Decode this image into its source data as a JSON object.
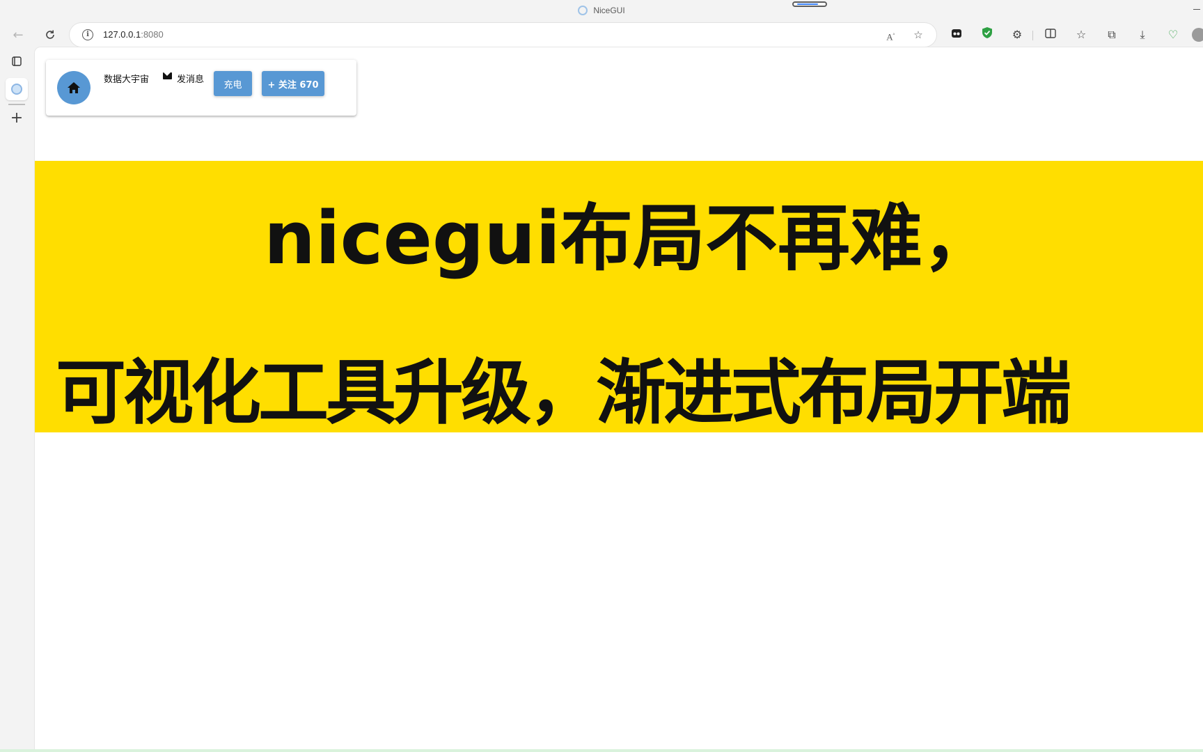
{
  "window": {
    "title": "NiceGUI"
  },
  "browser": {
    "url_host": "127.0.0.1",
    "url_port": ":8080",
    "icons": [
      "back-icon",
      "refresh-icon",
      "info-icon",
      "read-aloud-icon",
      "favorite-star-icon",
      "extension-icon",
      "shield-icon",
      "puzzle-icon",
      "split-screen-icon",
      "favorites-icon",
      "collections-icon",
      "download-icon",
      "heart-pulse-icon",
      "profile-icon"
    ]
  },
  "sidebar": {
    "icons": [
      "tab-actions-icon",
      "globe-icon",
      "plus-icon"
    ]
  },
  "card": {
    "name": "数据大宇宙",
    "message_label": "发消息",
    "charge_button": "充电",
    "follow_button": "+ 关注 670"
  },
  "banner": {
    "line1": "nicegui布局不再难，",
    "line2": "可视化工具升级，渐进式布局开端",
    "color": "#ffde00"
  },
  "colors": {
    "accent": "#5898d4"
  }
}
